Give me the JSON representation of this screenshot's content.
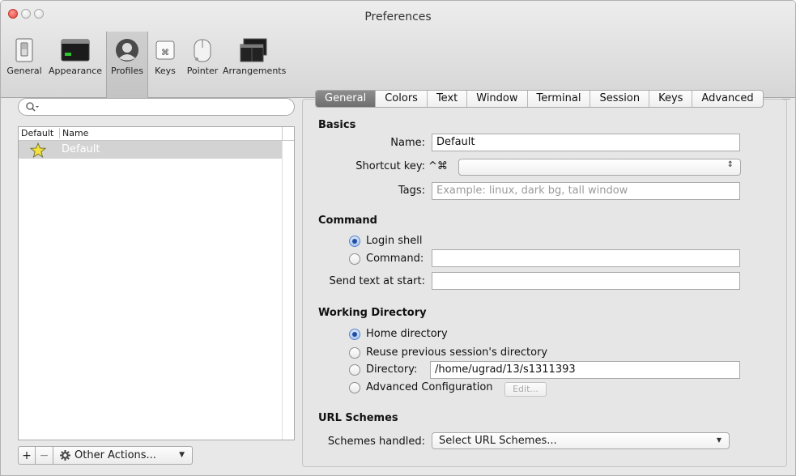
{
  "window": {
    "title": "Preferences"
  },
  "toolbar": {
    "items": [
      {
        "label": "General",
        "icon": "switch-icon"
      },
      {
        "label": "Appearance",
        "icon": "monitor-icon"
      },
      {
        "label": "Profiles",
        "icon": "person-icon",
        "selected": true
      },
      {
        "label": "Keys",
        "icon": "command-key-icon"
      },
      {
        "label": "Pointer",
        "icon": "mouse-icon"
      },
      {
        "label": "Arrangements",
        "icon": "windows-icon"
      }
    ]
  },
  "profiles": {
    "search_placeholder": "",
    "columns": {
      "default": "Default",
      "name": "Name"
    },
    "rows": [
      {
        "name": "Default",
        "is_default": true
      }
    ],
    "add_label": "+",
    "remove_label": "−",
    "other_actions_label": "Other Actions..."
  },
  "tabs": [
    "General",
    "Colors",
    "Text",
    "Window",
    "Terminal",
    "Session",
    "Keys",
    "Advanced"
  ],
  "active_tab": "General",
  "basics": {
    "heading": "Basics",
    "name_label": "Name:",
    "name_value": "Default",
    "shortcut_label": "Shortcut key:",
    "shortcut_prefix": "^⌘",
    "shortcut_value": "",
    "tags_label": "Tags:",
    "tags_placeholder": "Example: linux, dark bg, tall window"
  },
  "command": {
    "heading": "Command",
    "login_shell_label": "Login shell",
    "command_label": "Command:",
    "command_value": "",
    "selected": "login_shell",
    "send_text_label": "Send text at start:",
    "send_text_value": ""
  },
  "working_directory": {
    "heading": "Working Directory",
    "home_label": "Home directory",
    "reuse_label": "Reuse previous session's directory",
    "directory_label": "Directory:",
    "directory_value": "/home/ugrad/13/s1311393",
    "advanced_label": "Advanced Configuration",
    "edit_label": "Edit...",
    "selected": "home"
  },
  "url_schemes": {
    "heading": "URL Schemes",
    "schemes_label": "Schemes handled:",
    "schemes_value": "Select URL Schemes..."
  },
  "colors": {
    "selected_tab": "#7f7f7f",
    "radio_selected": "#1f4ea8",
    "star": "#f3e23a"
  }
}
